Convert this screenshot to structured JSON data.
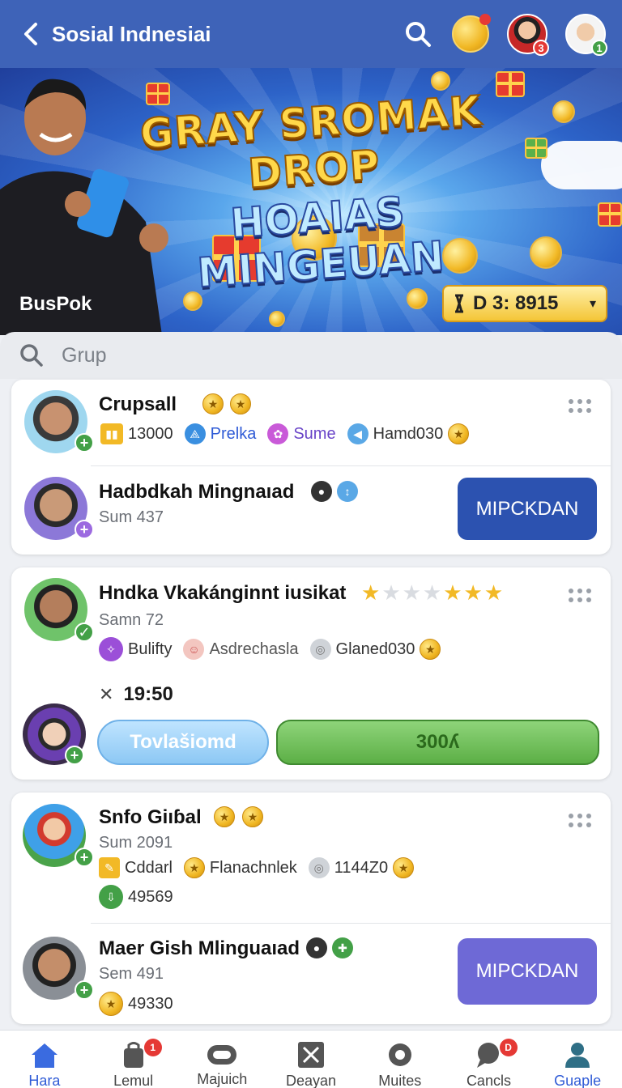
{
  "header": {
    "title": "Sosial Indnesiai",
    "avatar1_badge": "3",
    "avatar2_badge": "1"
  },
  "banner": {
    "headline_line1": "GRAY SROMAK DROP",
    "headline_line2": "HOAIAS MINGEUAN",
    "brand": "BusPok",
    "timer": "D 3: 8915",
    "colors": {
      "timer_bg": "#f4c637",
      "title_gold": "#ffd84a",
      "title_blue": "#bfeaff"
    }
  },
  "search": {
    "placeholder": "Grup"
  },
  "cards": [
    {
      "rows": [
        {
          "name": "Crupsall",
          "stats": [
            {
              "icon": "bars-icon",
              "text": "13000"
            },
            {
              "icon": "shield-icon",
              "text": "Prelka"
            },
            {
              "icon": "flower-icon",
              "text": "Sume"
            },
            {
              "icon": "megaphone-icon",
              "text": "Hamd030"
            }
          ]
        },
        {
          "name": "Hadbdkah Mingnaıad",
          "sub": "Sum 437",
          "button": "MIPCKDAN"
        }
      ]
    },
    {
      "rows": [
        {
          "name": "Hndka Vkakánginnt iusikat",
          "sub": "Samn 72",
          "stats": [
            {
              "icon": "badge-icon",
              "text": "Bulifty"
            },
            {
              "icon": "face-icon",
              "text": "Asdrechasla"
            },
            {
              "icon": "ring-icon",
              "text": "Glaned030"
            }
          ],
          "time": "19:50",
          "button_secondary": "Tovlašiomd",
          "button_primary": "300ʎ"
        }
      ]
    },
    {
      "rows": [
        {
          "name": "Snfo Giıɓal",
          "sub": "Sum 2091",
          "stats": [
            {
              "icon": "pencil-icon",
              "text": "Cddarl"
            },
            {
              "icon": "coin-icon",
              "text": "Flanachnlek"
            },
            {
              "icon": "ring-icon",
              "text": "1144Z0"
            }
          ],
          "extra": "49569"
        },
        {
          "name": "Maer Gish Mlinguaıad",
          "sub": "Sem 491",
          "extra": "49330",
          "button": "MIPCKDAN"
        }
      ]
    }
  ],
  "nav": {
    "tabs": [
      {
        "label": "Hara",
        "icon": "home-icon",
        "badge": ""
      },
      {
        "label": "Lemul",
        "icon": "bag-icon",
        "badge": "1"
      },
      {
        "label": "Majuich",
        "icon": "controller-icon",
        "badge": ""
      },
      {
        "label": "Deayan",
        "icon": "close-box-icon",
        "badge": ""
      },
      {
        "label": "Muites",
        "icon": "gear-icon",
        "badge": ""
      },
      {
        "label": "Cancls",
        "icon": "chat-icon",
        "badge": "D"
      },
      {
        "label": "Guaple",
        "icon": "person-icon",
        "badge": ""
      }
    ]
  }
}
